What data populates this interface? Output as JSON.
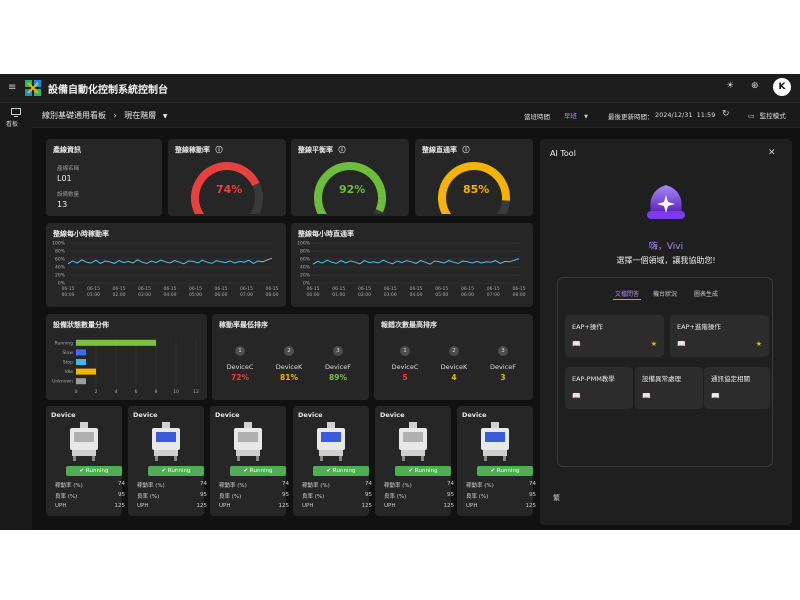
{
  "app": {
    "title": "設備自動化控制系統控制台",
    "avatar_letter": "K"
  },
  "rail": {
    "label": "看板"
  },
  "subbar": {
    "breadcrumb_root": "線別基礎通用看板",
    "breadcrumb_current": "現在階層",
    "shift_label": "當班時間",
    "shift_value": "早班",
    "updated_label": "最後更新時間：",
    "updated_value": "2024/12/31  11:59",
    "monitor_label": "監控模式"
  },
  "line_info": {
    "title": "產線資訊",
    "name_label": "產線名稱",
    "name_value": "L01",
    "count_label": "設備數量",
    "count_value": "13"
  },
  "gauges": [
    {
      "title": "整線稼動率",
      "value": 74,
      "display": "74%",
      "color": "#e8403f"
    },
    {
      "title": "整線平衡率",
      "value": 92,
      "display": "92%",
      "color": "#6cbd3a"
    },
    {
      "title": "整線直通率",
      "value": 85,
      "display": "85%",
      "color": "#f4b400"
    }
  ],
  "hourly": {
    "titles": [
      "整線每小時稼動率",
      "整線每小時直通率"
    ],
    "ylabels": [
      "100%",
      "80%",
      "60%",
      "40%",
      "20%",
      "0%"
    ],
    "xlabels": [
      "06-15\n00:00",
      "06-15\n01:00",
      "06-15\n02:00",
      "06-15\n03:00",
      "06-15\n04:00",
      "06-15\n05:00",
      "06-15\n06:00",
      "06-15\n07:00",
      "06-15\n08:00"
    ]
  },
  "chart_data": [
    {
      "type": "line",
      "title": "整線每小時稼動率",
      "ylim": [
        0,
        100
      ],
      "x": [
        "06-15 00:00",
        "06-15 01:00",
        "06-15 02:00",
        "06-15 03:00",
        "06-15 04:00",
        "06-15 05:00",
        "06-15 06:00",
        "06-15 07:00",
        "06-15 08:00"
      ],
      "values": [
        48,
        55,
        50,
        58,
        52,
        50,
        57,
        49,
        55,
        53,
        49,
        56,
        51,
        54,
        50,
        58,
        52,
        49,
        55,
        51,
        57,
        53,
        50,
        56,
        52,
        48,
        55,
        54,
        50,
        57,
        52,
        49,
        56,
        53,
        51,
        55,
        50,
        54,
        52,
        57,
        49,
        55,
        53,
        58,
        62
      ]
    },
    {
      "type": "line",
      "title": "整線每小時直通率",
      "ylim": [
        0,
        100
      ],
      "x": [
        "06-15 00:00",
        "06-15 01:00",
        "06-15 02:00",
        "06-15 03:00",
        "06-15 04:00",
        "06-15 05:00",
        "06-15 06:00",
        "06-15 07:00",
        "06-15 08:00"
      ],
      "values": [
        47,
        54,
        50,
        57,
        52,
        49,
        56,
        50,
        55,
        52,
        48,
        56,
        51,
        53,
        50,
        57,
        52,
        48,
        55,
        51,
        56,
        53,
        49,
        56,
        52,
        47,
        55,
        53,
        50,
        56,
        52,
        49,
        55,
        53,
        50,
        54,
        50,
        53,
        52,
        56,
        49,
        54,
        53,
        57,
        61
      ]
    },
    {
      "type": "bar",
      "title": "設備狀態數量分佈",
      "categories": [
        "Running",
        "Slow",
        "Stop",
        "Idle",
        "Unknown"
      ],
      "values": [
        8,
        1,
        1,
        2,
        1
      ],
      "xlim": [
        0,
        12
      ],
      "xticks": [
        "0",
        "2",
        "4",
        "6",
        "8",
        "10",
        "12"
      ],
      "colors": [
        "#7bc143",
        "#3d6fe0",
        "#46b5e8",
        "#f4b400",
        "#9e9e9e"
      ]
    }
  ],
  "status_dist": {
    "title": "設備狀態數量分佈"
  },
  "rank_low": {
    "title": "稼動率最低排序",
    "items": [
      {
        "n": "1",
        "name": "DeviceC",
        "val": "72%",
        "color": "#e8403f"
      },
      {
        "n": "2",
        "name": "DeviceK",
        "val": "81%",
        "color": "#f4b400"
      },
      {
        "n": "3",
        "name": "DeviceF",
        "val": "89%",
        "color": "#7bc143"
      }
    ]
  },
  "rank_alarm": {
    "title": "報錯次數最高排序",
    "items": [
      {
        "n": "1",
        "name": "DeviceC",
        "val": "5",
        "color": "#e8403f"
      },
      {
        "n": "2",
        "name": "DeviceK",
        "val": "4",
        "color": "#f4b400"
      },
      {
        "n": "3",
        "name": "DeviceF",
        "val": "3",
        "color": "#f4b400"
      }
    ]
  },
  "devices": [
    {
      "title": "Device",
      "status": "Running",
      "util": "74",
      "yield": "95",
      "uph": "125"
    },
    {
      "title": "Device",
      "status": "Running",
      "util": "74",
      "yield": "95",
      "uph": "125"
    },
    {
      "title": "Device",
      "status": "Running",
      "util": "74",
      "yield": "95",
      "uph": "125"
    },
    {
      "title": "Device",
      "status": "Running",
      "util": "74",
      "yield": "95",
      "uph": "125"
    },
    {
      "title": "Device",
      "status": "Running",
      "util": "74",
      "yield": "95",
      "uph": "125"
    },
    {
      "title": "Device",
      "status": "Running",
      "util": "74",
      "yield": "95",
      "uph": "125"
    }
  ],
  "device_labels": {
    "util": "稼動率 (%)",
    "yield": "良率 (%)",
    "uph": "UPH"
  },
  "ai": {
    "title": "AI Tool",
    "greeting": "嗨，Vivi",
    "prompt": "選擇一個領域，讓我協助您!",
    "tabs": [
      "文檔問答",
      "機台狀況",
      "圖表生成"
    ],
    "tiles": [
      {
        "label": "EAP+操作",
        "star": true
      },
      {
        "label": "EAP+進階操作",
        "star": true
      },
      {
        "label": "EAP-PMM教學",
        "star": false
      },
      {
        "label": "設備異常處理",
        "star": false
      },
      {
        "label": "通訊協定相關",
        "star": false
      }
    ],
    "footer": "繁"
  },
  "colors": {
    "accent": "#8b5cf6",
    "panel": "#262626",
    "line": "#4fc3f7"
  }
}
